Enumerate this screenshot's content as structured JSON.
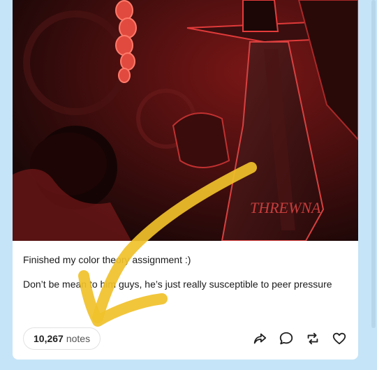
{
  "post": {
    "caption_lines": [
      "Finished my color theory assignment :)",
      "Don’t be mean to him guys, he’s just really susceptible to peer pressure"
    ],
    "notes_count": "10,267",
    "notes_label": "notes",
    "artwork_signature": "THREWNA"
  },
  "actions": {
    "share_icon": "share-arrow-icon",
    "reply_icon": "reply-bubble-icon",
    "reblog_icon": "reblog-icon",
    "like_icon": "heart-icon"
  },
  "colors": {
    "page_background": "#c6e4f7",
    "card_background": "#ffffff",
    "annotation_arrow": "#f0c12a",
    "artwork_red": "#d42a2a"
  }
}
